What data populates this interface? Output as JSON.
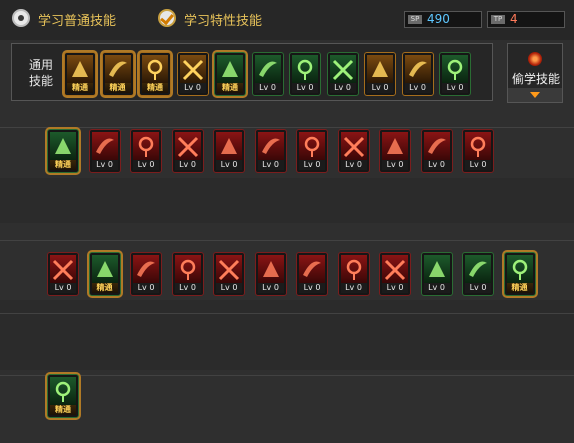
{
  "tabs": [
    {
      "label": "学习普通技能",
      "selected": false
    },
    {
      "label": "学习特性技能",
      "selected": true
    }
  ],
  "counters": [
    {
      "icon_text": "SP",
      "value": "490",
      "value_color": "#5ec7ff"
    },
    {
      "icon_text": "TP",
      "value": "4",
      "value_color": "#ff7a5a"
    }
  ],
  "common_skills": {
    "label": "通用技能",
    "items": [
      {
        "icon": "sit-meditate-icon",
        "level": "精通",
        "color": "yellow"
      },
      {
        "icon": "crouch-guard-icon",
        "level": "精通",
        "color": "yellow"
      },
      {
        "icon": "dash-runner-icon",
        "level": "精通",
        "color": "yellow"
      },
      {
        "icon": "winged-emblem-icon",
        "level": "Lv 0",
        "color": "yellow"
      },
      {
        "icon": "target-focus-icon",
        "level": "精通",
        "color": "green"
      },
      {
        "icon": "crosshair-icon",
        "level": "Lv 0",
        "color": "green"
      },
      {
        "icon": "kneel-fighter-icon",
        "level": "Lv 0",
        "color": "green"
      },
      {
        "icon": "summon-figure-icon",
        "level": "Lv 0",
        "color": "green"
      },
      {
        "icon": "spiral-vortex-icon",
        "level": "Lv 0",
        "color": "yellow"
      },
      {
        "icon": "raise-arms-icon",
        "level": "Lv 0",
        "color": "yellow"
      },
      {
        "icon": "jump-leap-icon",
        "level": "Lv 0",
        "color": "green"
      }
    ]
  },
  "steal_button": {
    "label": "偷学技能"
  },
  "skill_rows": [
    [
      {
        "icon": "sprint-mastery-icon",
        "level": "精通",
        "color": "green"
      },
      {
        "icon": "crescent-slash-icon",
        "level": "Lv 0",
        "color": "red"
      },
      {
        "icon": "claw-strike-icon",
        "level": "Lv 0",
        "color": "red"
      },
      {
        "icon": "triple-arrow-icon",
        "level": "Lv 0",
        "color": "red"
      },
      {
        "icon": "whirl-blade-icon",
        "level": "Lv 0",
        "color": "red"
      },
      {
        "icon": "shield-cross-icon",
        "level": "Lv 0",
        "color": "red"
      },
      {
        "icon": "double-crescent-icon",
        "level": "Lv 0",
        "color": "red"
      },
      {
        "icon": "spin-attack-icon",
        "level": "Lv 0",
        "color": "red"
      },
      {
        "icon": "crossed-beast-icon",
        "level": "Lv 0",
        "color": "red"
      },
      {
        "icon": "double-slash-icon",
        "level": "Lv 0",
        "color": "red"
      },
      {
        "icon": "diving-strike-icon",
        "level": "Lv 0",
        "color": "red"
      }
    ],
    [
      {
        "icon": "ground-strike-icon",
        "level": "Lv 0",
        "color": "red"
      },
      {
        "icon": "star-burst-icon",
        "level": "精通",
        "color": "green"
      },
      {
        "icon": "pillar-guard-icon",
        "level": "Lv 0",
        "color": "red"
      },
      {
        "icon": "crescent-wave-icon",
        "level": "Lv 0",
        "color": "red"
      },
      {
        "icon": "rush-slash-icon",
        "level": "Lv 0",
        "color": "red"
      },
      {
        "icon": "flame-rise-icon",
        "level": "Lv 0",
        "color": "red"
      },
      {
        "icon": "sweep-cut-icon",
        "level": "Lv 0",
        "color": "red"
      },
      {
        "icon": "blade-rain-icon",
        "level": "Lv 0",
        "color": "red"
      },
      {
        "icon": "twin-swords-icon",
        "level": "Lv 0",
        "color": "red"
      },
      {
        "icon": "wind-dancer-icon",
        "level": "Lv 0",
        "color": "green"
      },
      {
        "icon": "moon-slash-icon",
        "level": "Lv 0",
        "color": "green"
      },
      {
        "icon": "nova-burst-icon",
        "level": "精通",
        "color": "green"
      }
    ],
    [
      {
        "icon": "berserk-burst-icon",
        "level": "精通",
        "color": "green"
      }
    ]
  ]
}
